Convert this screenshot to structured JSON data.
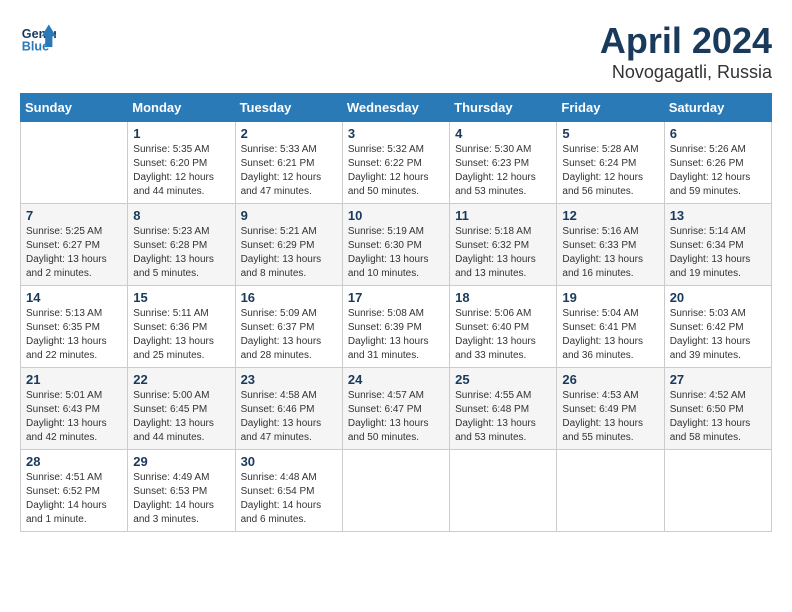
{
  "header": {
    "logo_line1": "General",
    "logo_line2": "Blue",
    "month": "April 2024",
    "location": "Novogagatli, Russia"
  },
  "weekdays": [
    "Sunday",
    "Monday",
    "Tuesday",
    "Wednesday",
    "Thursday",
    "Friday",
    "Saturday"
  ],
  "weeks": [
    [
      {
        "day": "",
        "info": ""
      },
      {
        "day": "1",
        "info": "Sunrise: 5:35 AM\nSunset: 6:20 PM\nDaylight: 12 hours\nand 44 minutes."
      },
      {
        "day": "2",
        "info": "Sunrise: 5:33 AM\nSunset: 6:21 PM\nDaylight: 12 hours\nand 47 minutes."
      },
      {
        "day": "3",
        "info": "Sunrise: 5:32 AM\nSunset: 6:22 PM\nDaylight: 12 hours\nand 50 minutes."
      },
      {
        "day": "4",
        "info": "Sunrise: 5:30 AM\nSunset: 6:23 PM\nDaylight: 12 hours\nand 53 minutes."
      },
      {
        "day": "5",
        "info": "Sunrise: 5:28 AM\nSunset: 6:24 PM\nDaylight: 12 hours\nand 56 minutes."
      },
      {
        "day": "6",
        "info": "Sunrise: 5:26 AM\nSunset: 6:26 PM\nDaylight: 12 hours\nand 59 minutes."
      }
    ],
    [
      {
        "day": "7",
        "info": "Sunrise: 5:25 AM\nSunset: 6:27 PM\nDaylight: 13 hours\nand 2 minutes."
      },
      {
        "day": "8",
        "info": "Sunrise: 5:23 AM\nSunset: 6:28 PM\nDaylight: 13 hours\nand 5 minutes."
      },
      {
        "day": "9",
        "info": "Sunrise: 5:21 AM\nSunset: 6:29 PM\nDaylight: 13 hours\nand 8 minutes."
      },
      {
        "day": "10",
        "info": "Sunrise: 5:19 AM\nSunset: 6:30 PM\nDaylight: 13 hours\nand 10 minutes."
      },
      {
        "day": "11",
        "info": "Sunrise: 5:18 AM\nSunset: 6:32 PM\nDaylight: 13 hours\nand 13 minutes."
      },
      {
        "day": "12",
        "info": "Sunrise: 5:16 AM\nSunset: 6:33 PM\nDaylight: 13 hours\nand 16 minutes."
      },
      {
        "day": "13",
        "info": "Sunrise: 5:14 AM\nSunset: 6:34 PM\nDaylight: 13 hours\nand 19 minutes."
      }
    ],
    [
      {
        "day": "14",
        "info": "Sunrise: 5:13 AM\nSunset: 6:35 PM\nDaylight: 13 hours\nand 22 minutes."
      },
      {
        "day": "15",
        "info": "Sunrise: 5:11 AM\nSunset: 6:36 PM\nDaylight: 13 hours\nand 25 minutes."
      },
      {
        "day": "16",
        "info": "Sunrise: 5:09 AM\nSunset: 6:37 PM\nDaylight: 13 hours\nand 28 minutes."
      },
      {
        "day": "17",
        "info": "Sunrise: 5:08 AM\nSunset: 6:39 PM\nDaylight: 13 hours\nand 31 minutes."
      },
      {
        "day": "18",
        "info": "Sunrise: 5:06 AM\nSunset: 6:40 PM\nDaylight: 13 hours\nand 33 minutes."
      },
      {
        "day": "19",
        "info": "Sunrise: 5:04 AM\nSunset: 6:41 PM\nDaylight: 13 hours\nand 36 minutes."
      },
      {
        "day": "20",
        "info": "Sunrise: 5:03 AM\nSunset: 6:42 PM\nDaylight: 13 hours\nand 39 minutes."
      }
    ],
    [
      {
        "day": "21",
        "info": "Sunrise: 5:01 AM\nSunset: 6:43 PM\nDaylight: 13 hours\nand 42 minutes."
      },
      {
        "day": "22",
        "info": "Sunrise: 5:00 AM\nSunset: 6:45 PM\nDaylight: 13 hours\nand 44 minutes."
      },
      {
        "day": "23",
        "info": "Sunrise: 4:58 AM\nSunset: 6:46 PM\nDaylight: 13 hours\nand 47 minutes."
      },
      {
        "day": "24",
        "info": "Sunrise: 4:57 AM\nSunset: 6:47 PM\nDaylight: 13 hours\nand 50 minutes."
      },
      {
        "day": "25",
        "info": "Sunrise: 4:55 AM\nSunset: 6:48 PM\nDaylight: 13 hours\nand 53 minutes."
      },
      {
        "day": "26",
        "info": "Sunrise: 4:53 AM\nSunset: 6:49 PM\nDaylight: 13 hours\nand 55 minutes."
      },
      {
        "day": "27",
        "info": "Sunrise: 4:52 AM\nSunset: 6:50 PM\nDaylight: 13 hours\nand 58 minutes."
      }
    ],
    [
      {
        "day": "28",
        "info": "Sunrise: 4:51 AM\nSunset: 6:52 PM\nDaylight: 14 hours\nand 1 minute."
      },
      {
        "day": "29",
        "info": "Sunrise: 4:49 AM\nSunset: 6:53 PM\nDaylight: 14 hours\nand 3 minutes."
      },
      {
        "day": "30",
        "info": "Sunrise: 4:48 AM\nSunset: 6:54 PM\nDaylight: 14 hours\nand 6 minutes."
      },
      {
        "day": "",
        "info": ""
      },
      {
        "day": "",
        "info": ""
      },
      {
        "day": "",
        "info": ""
      },
      {
        "day": "",
        "info": ""
      }
    ]
  ]
}
